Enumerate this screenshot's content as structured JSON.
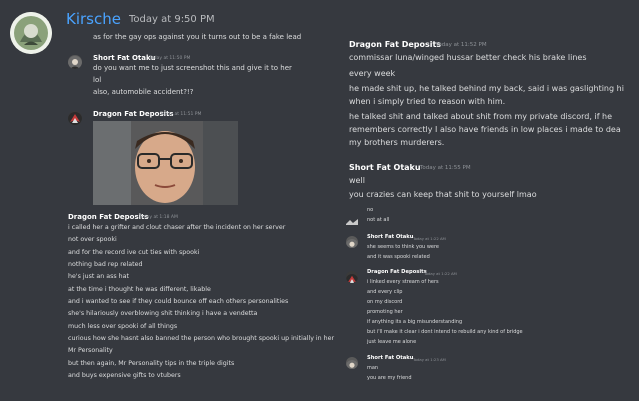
{
  "colors": {
    "background": "#36393f",
    "text": "#dcddde",
    "author": "#ffffff",
    "timestamp": "#8e9297",
    "kirsche_name": "#4aa3ff"
  },
  "left": {
    "header": {
      "author": "Kirsche",
      "timestamp": "Today at 9:50 PM",
      "line1": "as for the gay ops against you it turns out to be a fake lead"
    },
    "block1": {
      "author": "Short Fat Otaku",
      "timestamp": "Today at 11:50 PM",
      "lines": [
        "do you want me to just screenshot this and give it to her",
        "lol",
        "also, automobile accident?!?"
      ]
    },
    "block2": {
      "author": "Dragon Fat Deposits",
      "timestamp": "Today at 11:51 PM"
    },
    "block3": {
      "author": "Dragon Fat Deposits",
      "timestamp": "Today at 1:18 AM",
      "lines": [
        "i called her a grifter and clout chaser after the incident on her server",
        "not over spooki",
        "and for the record ive cut ties with spooki",
        "nothing bad rep related",
        "he's just an ass hat",
        "at the time i thought he was different, likable",
        "and i wanted to see if they could bounce off each others personalities",
        "she's hilariously overblowing shit thinking i have a vendetta",
        "much less over spooki of all things",
        "curious how she hasnt also banned the person who brought spooki up initially in her",
        "Mr Personality",
        "but then again, Mr Personality tips in the triple digits",
        "and buys expensive gifts to vtubers"
      ]
    }
  },
  "right": {
    "block1": {
      "author": "Dragon Fat Deposits",
      "timestamp": "Today at 11:52 PM",
      "lines": [
        "commissar luna/winged hussar better check his brake lines",
        "every week",
        "he made shit up, he talked behind my back, said i was gaslighting hi",
        "when i simply tried to reason with him.",
        "he talked shit and talked about shit from my private discord, if he",
        "remembers correctly I also have friends in low places i made to dea",
        "my brothers murderers."
      ]
    },
    "block2": {
      "author": "Short Fat Otaku",
      "timestamp": "Today at 11:55 PM",
      "lines": [
        "well",
        "you crazies can keep that shit to yourself lmao"
      ]
    },
    "block3": {
      "lines": [
        "no",
        "not at all"
      ]
    },
    "block4": {
      "author": "Short Fat Otaku",
      "timestamp": "Today at 1:22 AM",
      "lines": [
        "she seems to think you were",
        "and it was spooki related"
      ]
    },
    "block5": {
      "author": "Dragon Fat Deposits",
      "timestamp": "Today at 1:22 AM",
      "lines": [
        "i linked every stream of hers",
        "and every clip",
        "on my discord",
        "promoting her",
        "if anything its a big misunderstanding",
        "but i'll make it clear i dont intend to rebuild any kind of bridge",
        "just leave me alone"
      ]
    },
    "block6": {
      "author": "Short Fat Otaku",
      "timestamp": "Today at 1:23 AM",
      "lines": [
        "man",
        "you are my friend"
      ]
    }
  }
}
